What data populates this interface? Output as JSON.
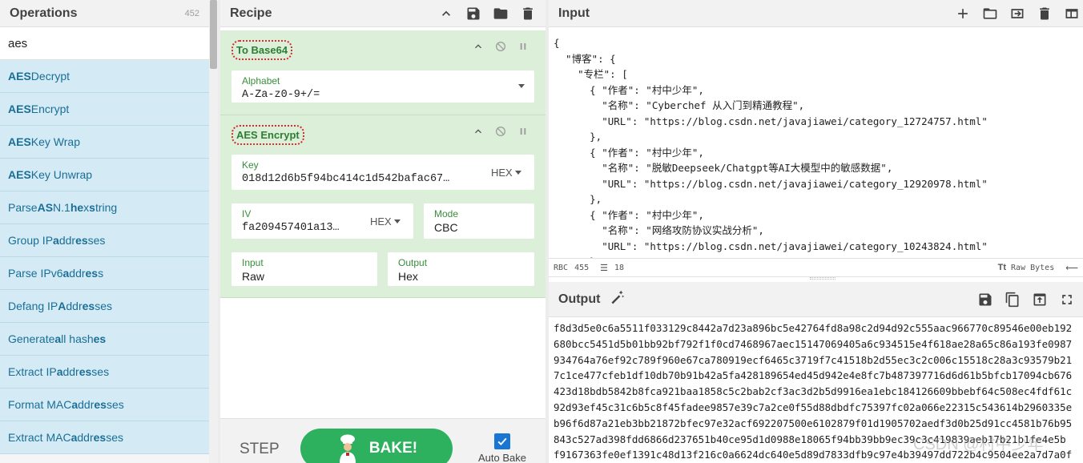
{
  "operations": {
    "title": "Operations",
    "count": "452",
    "search_value": "aes",
    "items": [
      {
        "parts": [
          [
            "AES",
            true
          ],
          [
            " Decrypt",
            false
          ]
        ]
      },
      {
        "parts": [
          [
            "AES",
            true
          ],
          [
            " Encrypt",
            false
          ]
        ]
      },
      {
        "parts": [
          [
            "AES",
            true
          ],
          [
            " Key Wrap",
            false
          ]
        ]
      },
      {
        "parts": [
          [
            "AES",
            true
          ],
          [
            " Key Unwrap",
            false
          ]
        ]
      },
      {
        "parts": [
          [
            "Parse ",
            false
          ],
          [
            "AS",
            true
          ],
          [
            "N.1 ",
            false
          ],
          [
            "he",
            true
          ],
          [
            "x ",
            false
          ],
          [
            "s",
            true
          ],
          [
            "tring",
            false
          ]
        ]
      },
      {
        "parts": [
          [
            "Group IP ",
            false
          ],
          [
            "a",
            true
          ],
          [
            "ddr",
            false
          ],
          [
            "es",
            true
          ],
          [
            "ses",
            false
          ]
        ]
      },
      {
        "parts": [
          [
            "Parse IPv6 ",
            false
          ],
          [
            "a",
            true
          ],
          [
            "ddr",
            false
          ],
          [
            "es",
            true
          ],
          [
            "s",
            false
          ]
        ]
      },
      {
        "parts": [
          [
            "Defang IP ",
            false
          ],
          [
            "A",
            true
          ],
          [
            "ddr",
            false
          ],
          [
            "es",
            true
          ],
          [
            "ses",
            false
          ]
        ]
      },
      {
        "parts": [
          [
            "Generate ",
            false
          ],
          [
            "a",
            true
          ],
          [
            "ll hash",
            false
          ],
          [
            "es",
            true
          ]
        ]
      },
      {
        "parts": [
          [
            "Extract IP ",
            false
          ],
          [
            "a",
            true
          ],
          [
            "ddr",
            false
          ],
          [
            "es",
            true
          ],
          [
            "ses",
            false
          ]
        ]
      },
      {
        "parts": [
          [
            "Format MAC ",
            false
          ],
          [
            "a",
            true
          ],
          [
            "ddr",
            false
          ],
          [
            "es",
            true
          ],
          [
            "ses",
            false
          ]
        ]
      },
      {
        "parts": [
          [
            "Extract MAC ",
            false
          ],
          [
            "a",
            true
          ],
          [
            "ddr",
            false
          ],
          [
            "es",
            true
          ],
          [
            "ses",
            false
          ]
        ]
      }
    ]
  },
  "recipe": {
    "title": "Recipe",
    "op1": {
      "name": "To Base64",
      "alphabet_label": "Alphabet",
      "alphabet_value": "A-Za-z0-9+/="
    },
    "op2": {
      "name": "AES Encrypt",
      "key_label": "Key",
      "key_value": "018d12d6b5f94bc414c1d542bafac67…",
      "key_format": "HEX",
      "iv_label": "IV",
      "iv_value": "fa209457401a13…",
      "iv_format": "HEX",
      "mode_label": "Mode",
      "mode_value": "CBC",
      "input_label": "Input",
      "input_value": "Raw",
      "output_label": "Output",
      "output_value": "Hex"
    },
    "step_label": "STEP",
    "bake_label": "BAKE!",
    "auto_bake_label": "Auto Bake",
    "auto_bake_checked": true
  },
  "input": {
    "title": "Input",
    "text": "{\n  \"博客\": {\n    \"专栏\": [\n      { \"作者\": \"村中少年\",\n        \"名称\": \"Cyberchef 从入门到精通教程\",\n        \"URL\": \"https://blog.csdn.net/javajiawei/category_12724757.html\"\n      },\n      { \"作者\": \"村中少年\",\n        \"名称\": \"脱敏Deepseek/Chatgpt等AI大模型中的敏感数据\",\n        \"URL\": \"https://blog.csdn.net/javajiawei/category_12920978.html\"\n      },\n      { \"作者\": \"村中少年\",\n        \"名称\": \"网络攻防协议实战分析\",\n        \"URL\": \"https://blog.csdn.net/javajiawei/category_10243824.html\"\n      },",
    "status_chars_label": "RBC",
    "status_chars": "455",
    "status_lines": "18",
    "status_format_icon": "Tt",
    "status_format": "Raw Bytes"
  },
  "output": {
    "title": "Output",
    "text": "f8d3d5e0c6a5511f033129c8442a7d23a896bc5e42764fd8a98c2d94d92c555aac966770c89546e00eb192\n680bcc5451d5b01bb92bf792f1f0cd7468967aec15147069405a6c934515e4f618ae28a65c86a193fe0987\n934764a76ef92c789f960e67ca780919ecf6465c3719f7c41518b2d55ec3c2c006c15518c28a3c93579b21\n7c1ce477cfeb1df10db70b91b42a5fa428189654ed45d942e4e8fc7b487397716d6d61b5bfcb17094cb676\n423d18bdb5842b8fca921baa1858c5c2bab2cf3ac3d2b5d9916ea1ebc184126609bbebf64c508ec4fdf61c\n92d93ef45c31c6b5c8f45fadee9857e39c7a2ce0f55d88dbdfc75397fc02a066e22315c543614b2960335e\nb96f6d87a21eb3bb21872bfec97e32acf692207500e6102879f01d1905702aedf3d0b25d91cc4581b76b95\n843c527ad398fdd6866d237651b40ce95d1d0988e18065f94bb39bb9ec39c3c419839aeb17b21b1fe4e5b\nf9167363fe0ef1391c48d13f216c0a6624dc640e5d89d7833dfb9c97e4b39497dd722b4c9504ee2a7d7a0f",
    "watermark": "CSDN @村中少年"
  }
}
